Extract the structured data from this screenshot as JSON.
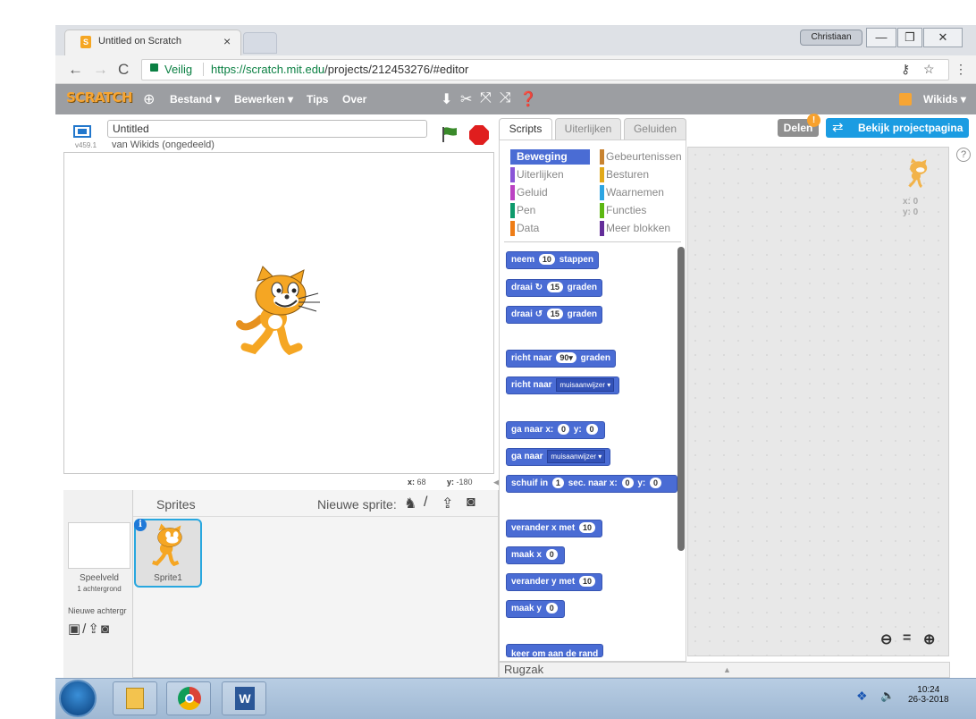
{
  "browser": {
    "tab_title": "Untitled on Scratch",
    "user": "Christiaan",
    "secure_label": "Veilig",
    "url_host": "https://scratch.mit.edu",
    "url_path": "/projects/212453276/#editor"
  },
  "menubar": {
    "logo": "SCRATCH",
    "items": [
      "Bestand ▾",
      "Bewerken ▾",
      "Tips",
      "Over"
    ],
    "user_label": "Wikids ▾"
  },
  "stage": {
    "version": "v459.1",
    "title_value": "Untitled",
    "byline": "van Wikids (ongedeeld)",
    "x_label": "x:",
    "x_value": "68",
    "y_label": "y:",
    "y_value": "-180"
  },
  "sprites": {
    "header": "Sprites",
    "new_sprite": "Nieuwe sprite:",
    "stage_name": "Speelveld",
    "stage_backdrops": "1 achtergrond",
    "new_backdrop": "Nieuwe achtergr",
    "sprite_name": "Sprite1"
  },
  "editor_tabs": [
    "Scripts",
    "Uiterlijken",
    "Geluiden"
  ],
  "share": {
    "delen": "Delen",
    "bekijk": "Bekijk projectpagina"
  },
  "categories": [
    {
      "label": "Beweging",
      "color": "#4a6cd4"
    },
    {
      "label": "Uiterlijken",
      "color": "#8a55d7"
    },
    {
      "label": "Geluid",
      "color": "#bb42c3"
    },
    {
      "label": "Pen",
      "color": "#0e9a6c"
    },
    {
      "label": "Data",
      "color": "#ee7d16"
    },
    {
      "label": "Gebeurtenissen",
      "color": "#c88330"
    },
    {
      "label": "Besturen",
      "color": "#e1a91a"
    },
    {
      "label": "Waarnemen",
      "color": "#2ca5e2"
    },
    {
      "label": "Functies",
      "color": "#5cb712"
    },
    {
      "label": "Meer blokken",
      "color": "#632d99"
    }
  ],
  "blocks": {
    "b1": {
      "a": "neem",
      "n1": "10",
      "b": "stappen"
    },
    "b2": {
      "a": "draai",
      "n1": "15",
      "b": "graden"
    },
    "b3": {
      "a": "draai",
      "n1": "15",
      "b": "graden"
    },
    "b4": {
      "a": "richt naar",
      "n1": "90▾",
      "b": "graden"
    },
    "b5": {
      "a": "richt naar",
      "d": "muisaanwijzer ▾"
    },
    "b6": {
      "a": "ga naar x:",
      "n1": "0",
      "b": "y:",
      "n2": "0"
    },
    "b7": {
      "a": "ga naar",
      "d": "muisaanwijzer ▾"
    },
    "b8": {
      "a": "schuif in",
      "n1": "1",
      "b": "sec. naar x:",
      "n2": "0",
      "c": "y:",
      "n3": "0"
    },
    "b9": {
      "a": "verander x met",
      "n1": "10"
    },
    "b10": {
      "a": "maak x",
      "n1": "0"
    },
    "b11": {
      "a": "verander y met",
      "n1": "10"
    },
    "b12": {
      "a": "maak y",
      "n1": "0"
    },
    "b13": {
      "a": "keer om aan de rand"
    }
  },
  "script_area": {
    "x": "x: 0",
    "y": "y: 0"
  },
  "backpack": "Rugzak",
  "taskbar": {
    "time": "10:24",
    "date": "26-3-2018"
  }
}
